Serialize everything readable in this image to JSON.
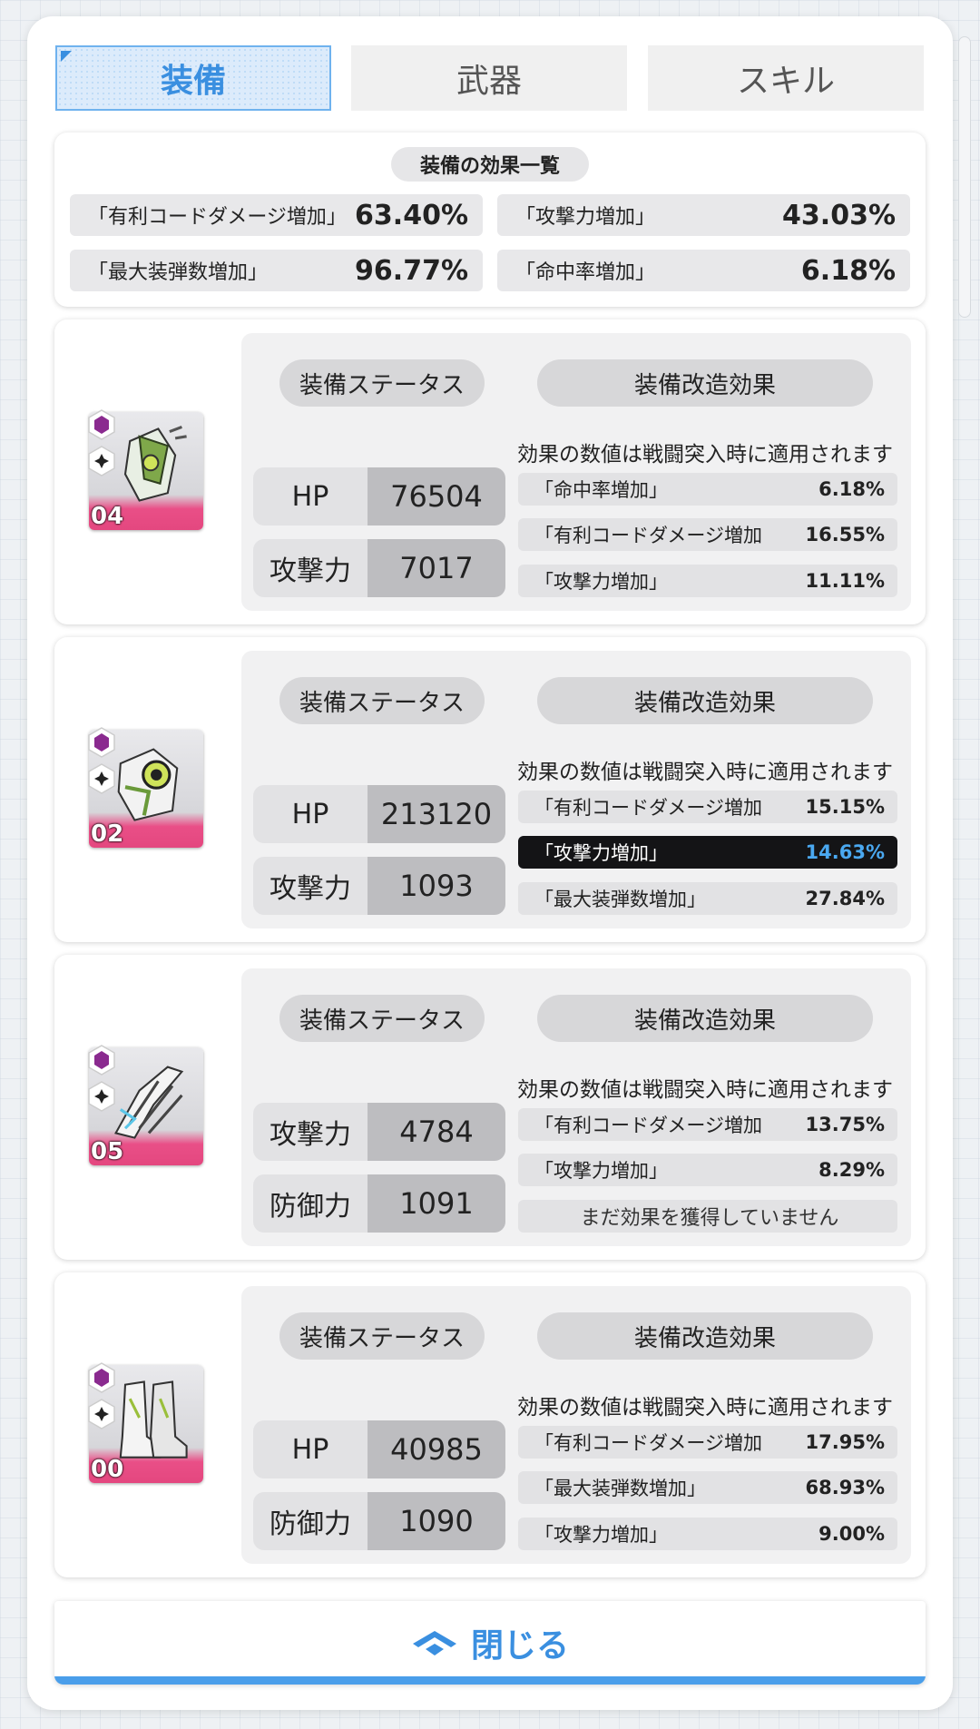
{
  "tabs": [
    {
      "label": "装備",
      "active": true
    },
    {
      "label": "武器",
      "active": false
    },
    {
      "label": "スキル",
      "active": false
    }
  ],
  "summary": {
    "title": "装備の効果一覧",
    "items": [
      {
        "label": "「有利コードダメージ増加」",
        "value": "63.40%"
      },
      {
        "label": "「攻撃力増加」",
        "value": "43.03%"
      },
      {
        "label": "「最大装弾数増加」",
        "value": "96.77%"
      },
      {
        "label": "「命中率増加」",
        "value": "6.18%"
      }
    ]
  },
  "equipment_common": {
    "status_label": "装備ステータス",
    "mod_label": "装備改造効果",
    "note": "効果の数値は戦闘突入時に適用されます"
  },
  "equipment": [
    {
      "level": "04",
      "stats": [
        {
          "label": "HP",
          "value": "76504"
        },
        {
          "label": "攻撃力",
          "value": "7017"
        }
      ],
      "effects": [
        {
          "label": "「命中率増加」",
          "value": "6.18%"
        },
        {
          "label": "「有利コードダメージ増加",
          "value": "16.55%"
        },
        {
          "label": "「攻撃力増加」",
          "value": "11.11%"
        }
      ]
    },
    {
      "level": "02",
      "stats": [
        {
          "label": "HP",
          "value": "213120"
        },
        {
          "label": "攻撃力",
          "value": "1093"
        }
      ],
      "effects": [
        {
          "label": "「有利コードダメージ増加",
          "value": "15.15%"
        },
        {
          "label": "「攻撃力増加」",
          "value": "14.63%",
          "highlight": true
        },
        {
          "label": "「最大装弾数増加」",
          "value": "27.84%"
        }
      ]
    },
    {
      "level": "05",
      "stats": [
        {
          "label": "攻撃力",
          "value": "4784"
        },
        {
          "label": "防御力",
          "value": "1091"
        }
      ],
      "effects": [
        {
          "label": "「有利コードダメージ増加",
          "value": "13.75%"
        },
        {
          "label": "「攻撃力増加」",
          "value": "8.29%"
        },
        {
          "label": "まだ効果を獲得していません",
          "value": ""
        }
      ]
    },
    {
      "level": "00",
      "stats": [
        {
          "label": "HP",
          "value": "40985"
        },
        {
          "label": "防御力",
          "value": "1090"
        }
      ],
      "effects": [
        {
          "label": "「有利コードダメージ増加",
          "value": "17.95%"
        },
        {
          "label": "「最大装弾数増加」",
          "value": "68.93%"
        },
        {
          "label": "「攻撃力増加」",
          "value": "9.00%"
        }
      ]
    }
  ],
  "close_button": {
    "label": "閉じる"
  },
  "colors": {
    "accent": "#3a8fe0",
    "highlight_value": "#4aa8f0",
    "thumb_band": "#e94f87"
  },
  "icons": [
    "chevron-up-icon",
    "code-badge-icon",
    "clover-badge-icon"
  ]
}
